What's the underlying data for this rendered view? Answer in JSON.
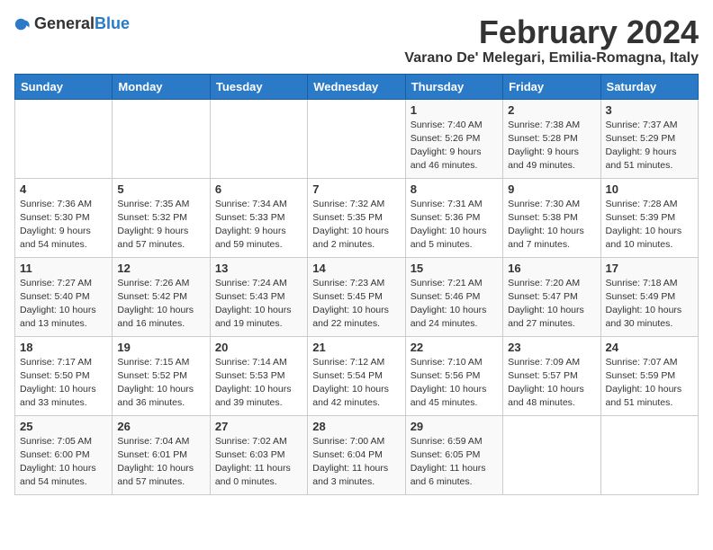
{
  "header": {
    "logo_general": "General",
    "logo_blue": "Blue",
    "month_title": "February 2024",
    "location": "Varano De' Melegari, Emilia-Romagna, Italy"
  },
  "days_of_week": [
    "Sunday",
    "Monday",
    "Tuesday",
    "Wednesday",
    "Thursday",
    "Friday",
    "Saturday"
  ],
  "weeks": [
    [
      {
        "day": "",
        "info": ""
      },
      {
        "day": "",
        "info": ""
      },
      {
        "day": "",
        "info": ""
      },
      {
        "day": "",
        "info": ""
      },
      {
        "day": "1",
        "info": "Sunrise: 7:40 AM\nSunset: 5:26 PM\nDaylight: 9 hours\nand 46 minutes."
      },
      {
        "day": "2",
        "info": "Sunrise: 7:38 AM\nSunset: 5:28 PM\nDaylight: 9 hours\nand 49 minutes."
      },
      {
        "day": "3",
        "info": "Sunrise: 7:37 AM\nSunset: 5:29 PM\nDaylight: 9 hours\nand 51 minutes."
      }
    ],
    [
      {
        "day": "4",
        "info": "Sunrise: 7:36 AM\nSunset: 5:30 PM\nDaylight: 9 hours\nand 54 minutes."
      },
      {
        "day": "5",
        "info": "Sunrise: 7:35 AM\nSunset: 5:32 PM\nDaylight: 9 hours\nand 57 minutes."
      },
      {
        "day": "6",
        "info": "Sunrise: 7:34 AM\nSunset: 5:33 PM\nDaylight: 9 hours\nand 59 minutes."
      },
      {
        "day": "7",
        "info": "Sunrise: 7:32 AM\nSunset: 5:35 PM\nDaylight: 10 hours\nand 2 minutes."
      },
      {
        "day": "8",
        "info": "Sunrise: 7:31 AM\nSunset: 5:36 PM\nDaylight: 10 hours\nand 5 minutes."
      },
      {
        "day": "9",
        "info": "Sunrise: 7:30 AM\nSunset: 5:38 PM\nDaylight: 10 hours\nand 7 minutes."
      },
      {
        "day": "10",
        "info": "Sunrise: 7:28 AM\nSunset: 5:39 PM\nDaylight: 10 hours\nand 10 minutes."
      }
    ],
    [
      {
        "day": "11",
        "info": "Sunrise: 7:27 AM\nSunset: 5:40 PM\nDaylight: 10 hours\nand 13 minutes."
      },
      {
        "day": "12",
        "info": "Sunrise: 7:26 AM\nSunset: 5:42 PM\nDaylight: 10 hours\nand 16 minutes."
      },
      {
        "day": "13",
        "info": "Sunrise: 7:24 AM\nSunset: 5:43 PM\nDaylight: 10 hours\nand 19 minutes."
      },
      {
        "day": "14",
        "info": "Sunrise: 7:23 AM\nSunset: 5:45 PM\nDaylight: 10 hours\nand 22 minutes."
      },
      {
        "day": "15",
        "info": "Sunrise: 7:21 AM\nSunset: 5:46 PM\nDaylight: 10 hours\nand 24 minutes."
      },
      {
        "day": "16",
        "info": "Sunrise: 7:20 AM\nSunset: 5:47 PM\nDaylight: 10 hours\nand 27 minutes."
      },
      {
        "day": "17",
        "info": "Sunrise: 7:18 AM\nSunset: 5:49 PM\nDaylight: 10 hours\nand 30 minutes."
      }
    ],
    [
      {
        "day": "18",
        "info": "Sunrise: 7:17 AM\nSunset: 5:50 PM\nDaylight: 10 hours\nand 33 minutes."
      },
      {
        "day": "19",
        "info": "Sunrise: 7:15 AM\nSunset: 5:52 PM\nDaylight: 10 hours\nand 36 minutes."
      },
      {
        "day": "20",
        "info": "Sunrise: 7:14 AM\nSunset: 5:53 PM\nDaylight: 10 hours\nand 39 minutes."
      },
      {
        "day": "21",
        "info": "Sunrise: 7:12 AM\nSunset: 5:54 PM\nDaylight: 10 hours\nand 42 minutes."
      },
      {
        "day": "22",
        "info": "Sunrise: 7:10 AM\nSunset: 5:56 PM\nDaylight: 10 hours\nand 45 minutes."
      },
      {
        "day": "23",
        "info": "Sunrise: 7:09 AM\nSunset: 5:57 PM\nDaylight: 10 hours\nand 48 minutes."
      },
      {
        "day": "24",
        "info": "Sunrise: 7:07 AM\nSunset: 5:59 PM\nDaylight: 10 hours\nand 51 minutes."
      }
    ],
    [
      {
        "day": "25",
        "info": "Sunrise: 7:05 AM\nSunset: 6:00 PM\nDaylight: 10 hours\nand 54 minutes."
      },
      {
        "day": "26",
        "info": "Sunrise: 7:04 AM\nSunset: 6:01 PM\nDaylight: 10 hours\nand 57 minutes."
      },
      {
        "day": "27",
        "info": "Sunrise: 7:02 AM\nSunset: 6:03 PM\nDaylight: 11 hours\nand 0 minutes."
      },
      {
        "day": "28",
        "info": "Sunrise: 7:00 AM\nSunset: 6:04 PM\nDaylight: 11 hours\nand 3 minutes."
      },
      {
        "day": "29",
        "info": "Sunrise: 6:59 AM\nSunset: 6:05 PM\nDaylight: 11 hours\nand 6 minutes."
      },
      {
        "day": "",
        "info": ""
      },
      {
        "day": "",
        "info": ""
      }
    ]
  ]
}
